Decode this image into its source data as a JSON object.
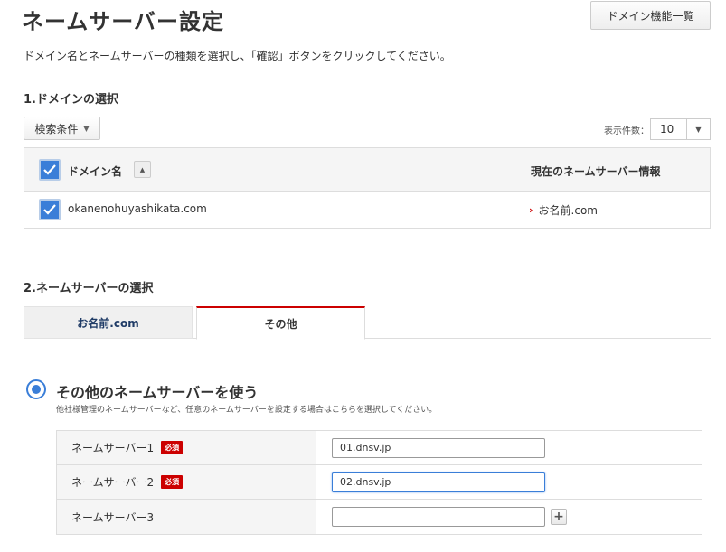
{
  "header": {
    "title": "ネームサーバー設定",
    "domain_list_button": "ドメイン機能一覧"
  },
  "description": "ドメイン名とネームサーバーの種類を選択し、「確認」ボタンをクリックしてください。",
  "section1": {
    "title": "1.ドメインの選択",
    "search_button": "検索条件",
    "count_label": "表示件数：",
    "count_value": "10",
    "table": {
      "col_domain": "ドメイン名",
      "col_ns": "現在のネームサーバー情報",
      "rows": [
        {
          "domain": "okanenohuyashikata.com",
          "ns": "お名前.com",
          "checked": true
        }
      ]
    }
  },
  "section2": {
    "title": "2.ネームサーバーの選択",
    "tabs": [
      {
        "label": "お名前.com",
        "active": false
      },
      {
        "label": "その他",
        "active": true
      }
    ],
    "option_title": "その他のネームサーバーを使う",
    "option_desc": "他社様管理のネームサーバーなど、任意のネームサーバーを設定する場合はこちらを選択してください。",
    "required_label": "必須",
    "nameservers": [
      {
        "label": "ネームサーバー1",
        "value": "01.dnsv.jp",
        "required": true
      },
      {
        "label": "ネームサーバー2",
        "value": "02.dnsv.jp",
        "required": true
      },
      {
        "label": "ネームサーバー3",
        "value": "",
        "required": false
      }
    ]
  },
  "colors": {
    "accent_blue": "#3a7ed8",
    "required_red": "#cc0000"
  }
}
